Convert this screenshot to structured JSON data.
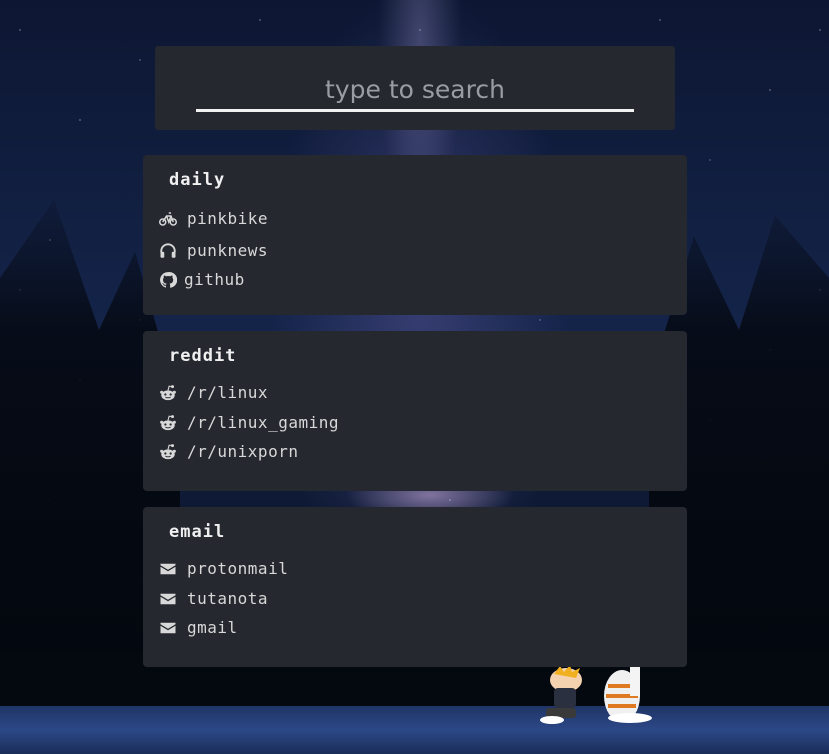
{
  "search": {
    "placeholder": "type to search"
  },
  "cards": [
    {
      "title": "daily",
      "links": [
        {
          "label": "pinkbike",
          "icon": "bicycle-icon"
        },
        {
          "label": "punknews",
          "icon": "headphones-icon"
        },
        {
          "label": "github",
          "icon": "github-icon"
        }
      ]
    },
    {
      "title": "reddit",
      "links": [
        {
          "label": "/r/linux",
          "icon": "reddit-icon"
        },
        {
          "label": "/r/linux_gaming",
          "icon": "reddit-icon"
        },
        {
          "label": "/r/unixporn",
          "icon": "reddit-icon"
        }
      ]
    },
    {
      "title": "email",
      "links": [
        {
          "label": "protonmail",
          "icon": "envelope-icon"
        },
        {
          "label": "tutanota",
          "icon": "envelope-icon"
        },
        {
          "label": "gmail",
          "icon": "envelope-icon"
        }
      ]
    }
  ],
  "colors": {
    "card_bg": "#262830",
    "text": "#d8d8d8",
    "search_underline": "#f2f2f2"
  }
}
